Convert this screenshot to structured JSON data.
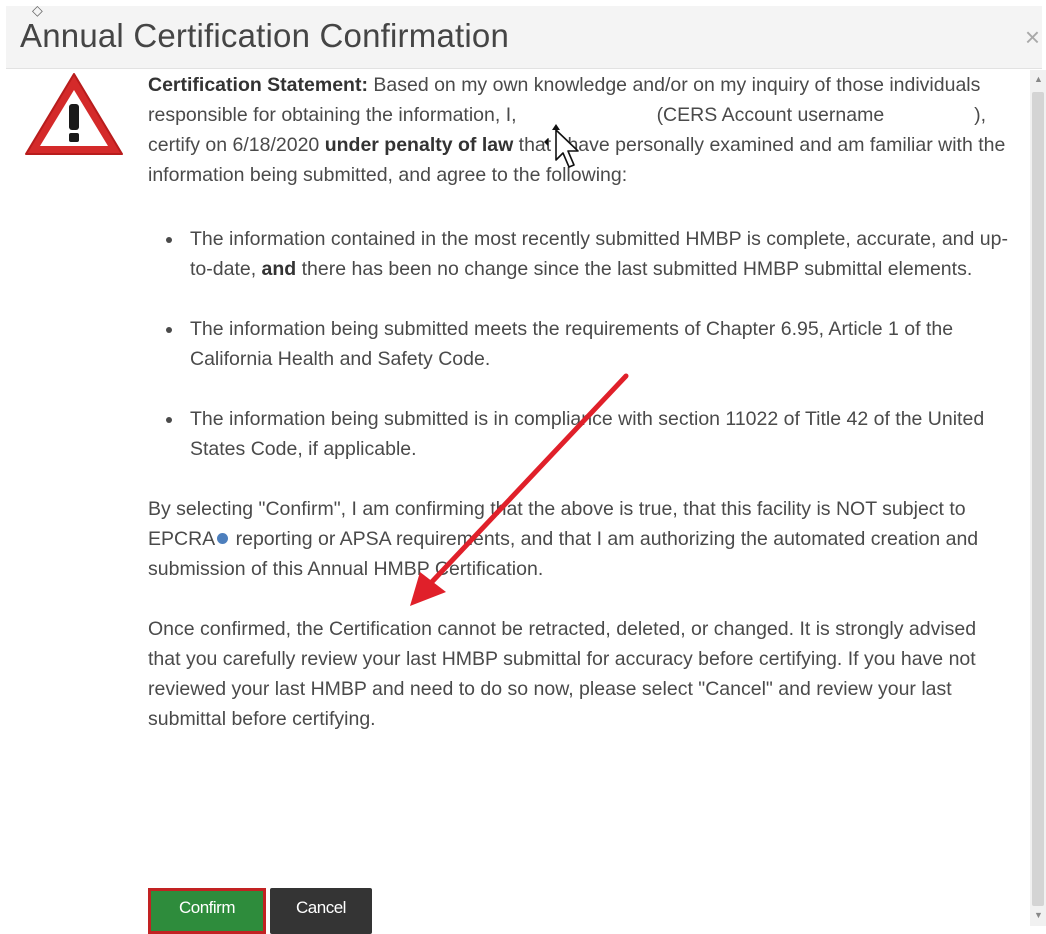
{
  "dialog": {
    "title": "Annual Certification Confirmation",
    "close_glyph": "×"
  },
  "statement": {
    "label": "Certification Statement:",
    "text_1": " Based on my own knowledge and/or on my inquiry of those individuals responsible for obtaining the information, I,",
    "text_2": "(CERS Account username",
    "text_3": "), certify on 6/18/2020",
    "penalty": "under penalty of law",
    "text_4": " that I have personally examined and am familiar with the information being submitted, and agree to the following:"
  },
  "requirements": [
    {
      "pre": "The information contained in the most recently submitted HMBP is complete, accurate, and up-to-date, ",
      "bold": "and",
      "post": " there has been no change since the last submitted HMBP submittal elements."
    },
    {
      "text": "The information being submitted meets the requirements of Chapter 6.95, Article 1 of the California Health and Safety Code."
    },
    {
      "text": "The information being submitted is in compliance with section 11022 of Title 42 of the United States Code, if applicable."
    }
  ],
  "confirm_paragraph": {
    "pre": "By selecting \"Confirm\", I am confirming that the above is true, that this facility is NOT subject to EPCRA",
    "post": " reporting or APSA requirements, and that I am authorizing the automated creation and submission of this Annual HMBP Certification."
  },
  "warning_paragraph": "Once confirmed, the Certification cannot be retracted, deleted, or changed. It is strongly advised that you carefully review your last HMBP submittal for accuracy before certifying. If you have not reviewed your last HMBP and need to do so now, please select \"Cancel\" and review your last submittal before certifying.",
  "buttons": {
    "confirm": "Confirm",
    "cancel": "Cancel"
  },
  "icons": {
    "warning": "warning-triangle-icon",
    "info": "info-icon",
    "cursor": "mouse-cursor-icon",
    "annotation_arrow": "red-arrow-annotation"
  },
  "colors": {
    "confirm_bg": "#2e8c3c",
    "confirm_border": "#c22222",
    "cancel_bg": "#343434",
    "warning_red": "#d42a2a",
    "arrow_red": "#e0202a",
    "info_blue": "#4d7fbd"
  }
}
